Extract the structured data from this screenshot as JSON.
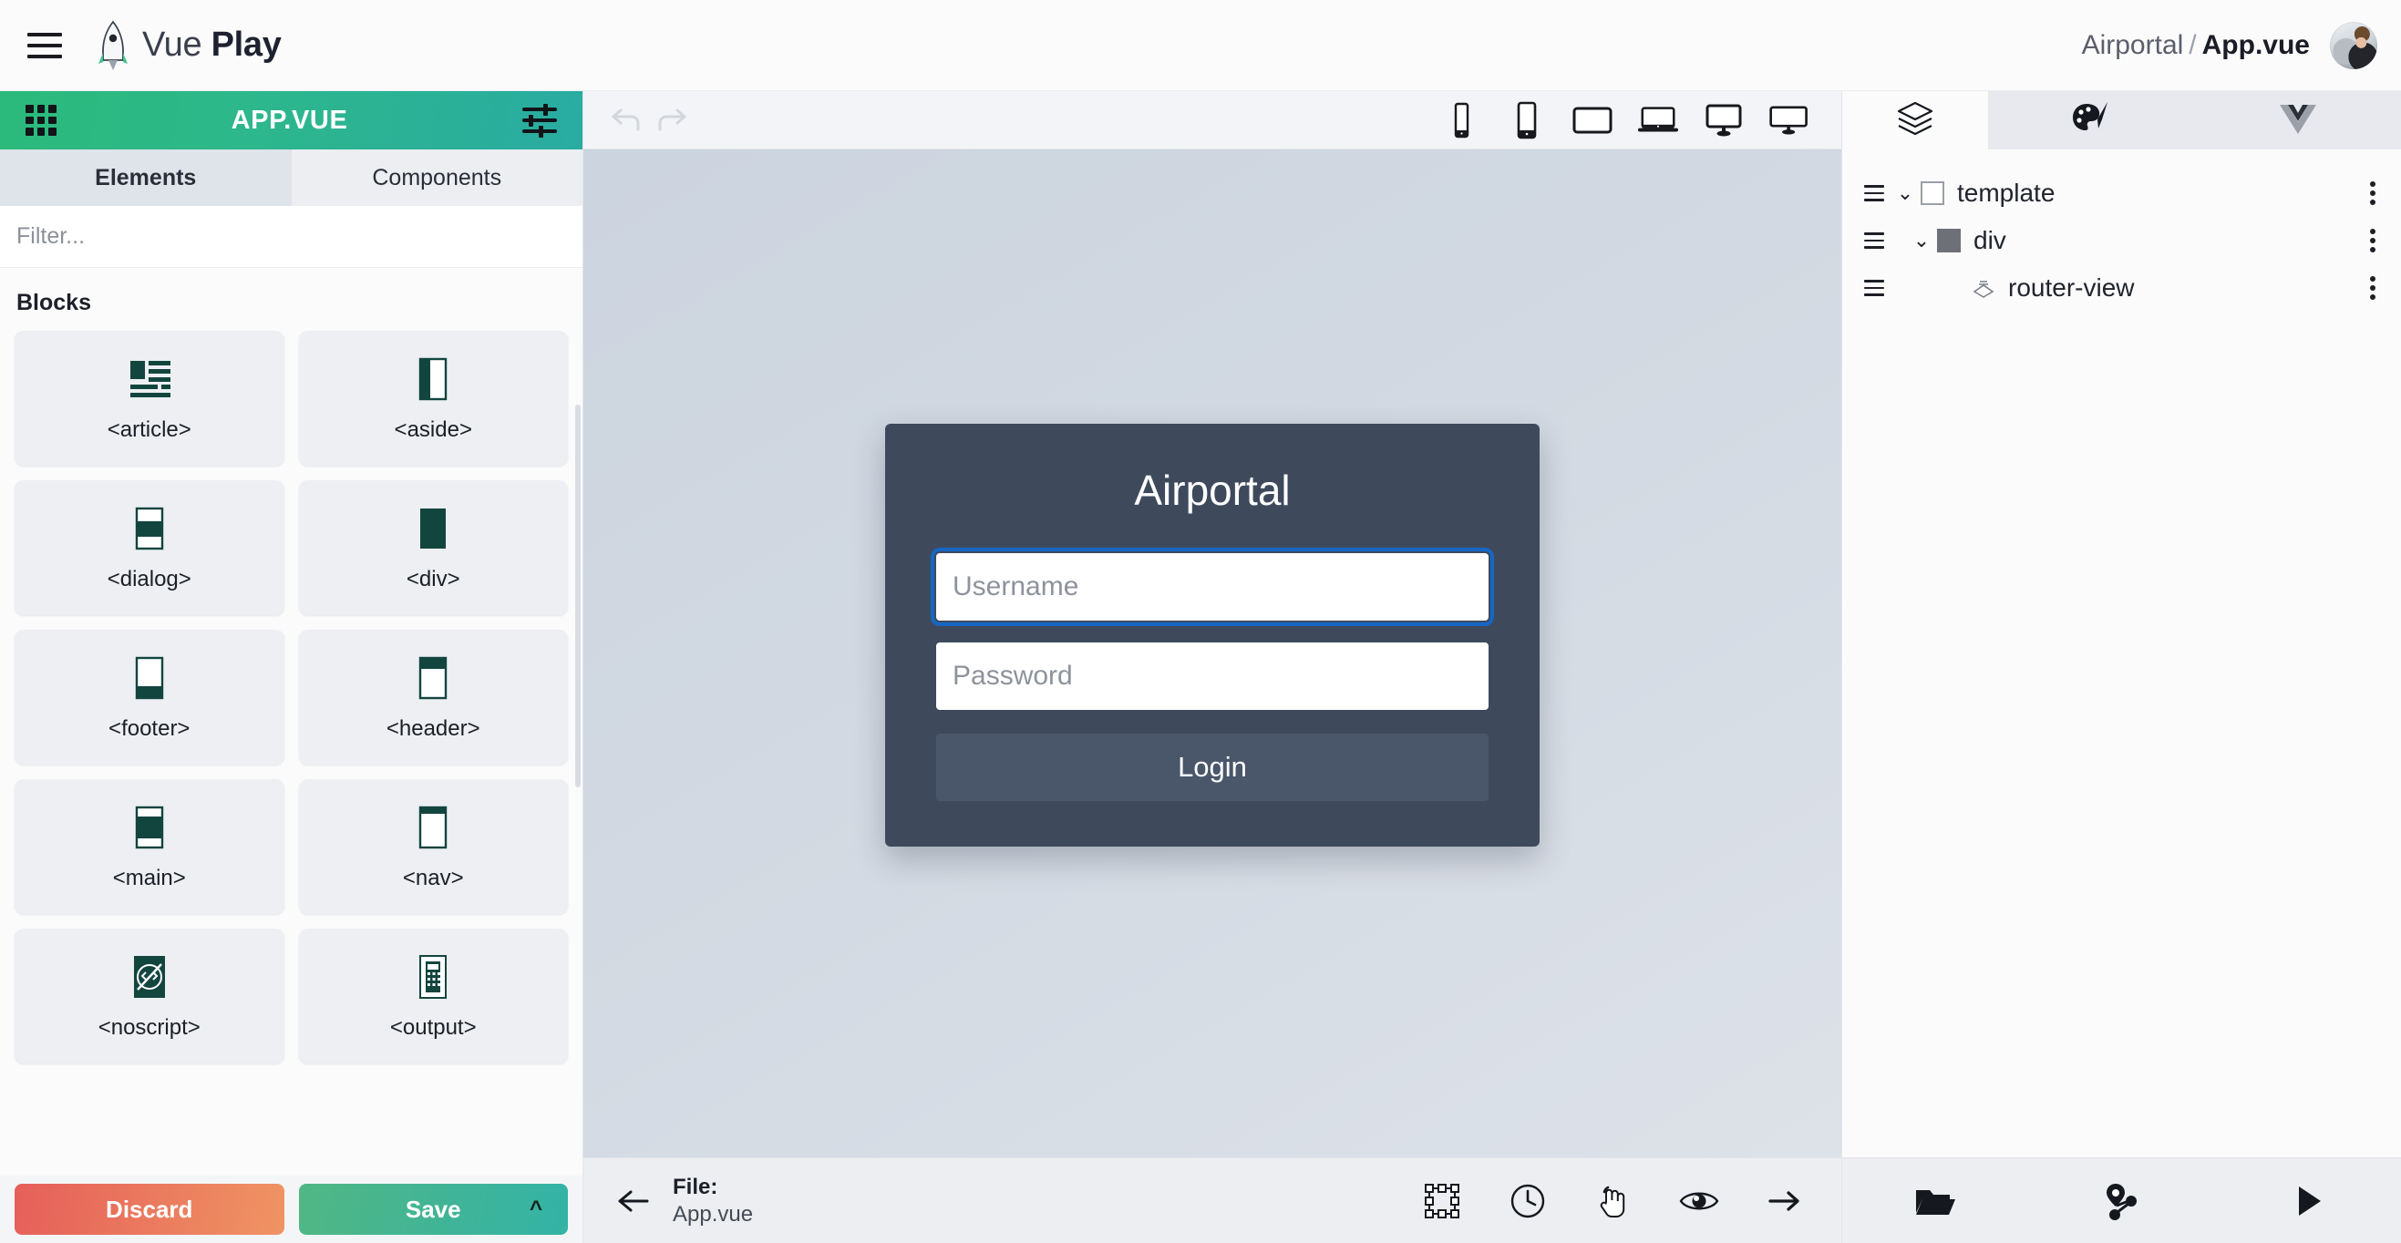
{
  "topbar": {
    "menu_icon": "hamburger-icon",
    "logo_icon": "rocket-icon",
    "brand_part1": "Vue",
    "brand_part2": "Play",
    "breadcrumb_project": "Airportal",
    "breadcrumb_separator": "/",
    "breadcrumb_current": "App.vue",
    "avatar_icon": "user-avatar"
  },
  "left_panel": {
    "header": {
      "grid_icon": "grid-icon",
      "title": "APP.VUE",
      "settings_icon": "sliders-icon",
      "gradient_from": "#2bba7b",
      "gradient_to": "#29aba2"
    },
    "tabs": [
      {
        "label": "Elements",
        "active": true
      },
      {
        "label": "Components",
        "active": false
      }
    ],
    "filter": {
      "value": "",
      "placeholder": "Filter..."
    },
    "section_title": "Blocks",
    "blocks": [
      {
        "label": "<article>",
        "icon": "article-block-icon"
      },
      {
        "label": "<aside>",
        "icon": "aside-block-icon"
      },
      {
        "label": "<dialog>",
        "icon": "dialog-block-icon"
      },
      {
        "label": "<div>",
        "icon": "div-block-icon"
      },
      {
        "label": "<footer>",
        "icon": "footer-block-icon"
      },
      {
        "label": "<header>",
        "icon": "header-block-icon"
      },
      {
        "label": "<main>",
        "icon": "main-block-icon"
      },
      {
        "label": "<nav>",
        "icon": "nav-block-icon"
      },
      {
        "label": "<noscript>",
        "icon": "noscript-block-icon"
      },
      {
        "label": "<output>",
        "icon": "output-block-icon"
      }
    ],
    "actions": {
      "discard_label": "Discard",
      "save_label": "Save",
      "save_expand_icon": "chevron-up-icon",
      "discard_color": "#e55f5a",
      "save_color": "#51b684"
    }
  },
  "canvas_toolbar": {
    "undo_icon": "undo-icon",
    "redo_icon": "redo-icon",
    "devices": [
      {
        "name": "phone-small-icon",
        "label": "Mobile S"
      },
      {
        "name": "phone-large-icon",
        "label": "Mobile L"
      },
      {
        "name": "tablet-icon",
        "label": "Tablet"
      },
      {
        "name": "laptop-icon",
        "label": "Laptop"
      },
      {
        "name": "desktop-icon",
        "label": "Desktop"
      },
      {
        "name": "desktop-large-icon",
        "label": "Desktop L"
      }
    ]
  },
  "preview": {
    "title": "Airportal",
    "username_placeholder": "Username",
    "password_placeholder": "Password",
    "username_value": "",
    "password_value": "",
    "login_label": "Login",
    "card_bg": "#3e4a5c",
    "focus_color": "#1667c4"
  },
  "bottom_bar": {
    "back_icon": "arrow-left-icon",
    "file_label": "File:",
    "file_value": "App.vue",
    "tools": [
      {
        "name": "select-transform-icon"
      },
      {
        "name": "history-clock-icon"
      },
      {
        "name": "pointer-hand-icon"
      },
      {
        "name": "preview-eye-icon"
      },
      {
        "name": "arrow-right-icon"
      }
    ]
  },
  "right_panel": {
    "tabs": [
      {
        "name": "layers-icon",
        "active": true
      },
      {
        "name": "palette-brush-icon",
        "active": false
      },
      {
        "name": "vue-logo-icon",
        "active": false
      }
    ],
    "tree": [
      {
        "label": "template",
        "depth": 0,
        "expanded": true,
        "icon": "hollow-square-icon",
        "has_toggle": true
      },
      {
        "label": "div",
        "depth": 1,
        "expanded": true,
        "icon": "filled-square-icon",
        "has_toggle": true
      },
      {
        "label": "router-view",
        "depth": 2,
        "expanded": false,
        "icon": "router-view-icon",
        "has_toggle": false
      }
    ],
    "footer_tools": [
      {
        "name": "open-folder-icon"
      },
      {
        "name": "routes-share-icon"
      },
      {
        "name": "play-icon"
      }
    ]
  }
}
